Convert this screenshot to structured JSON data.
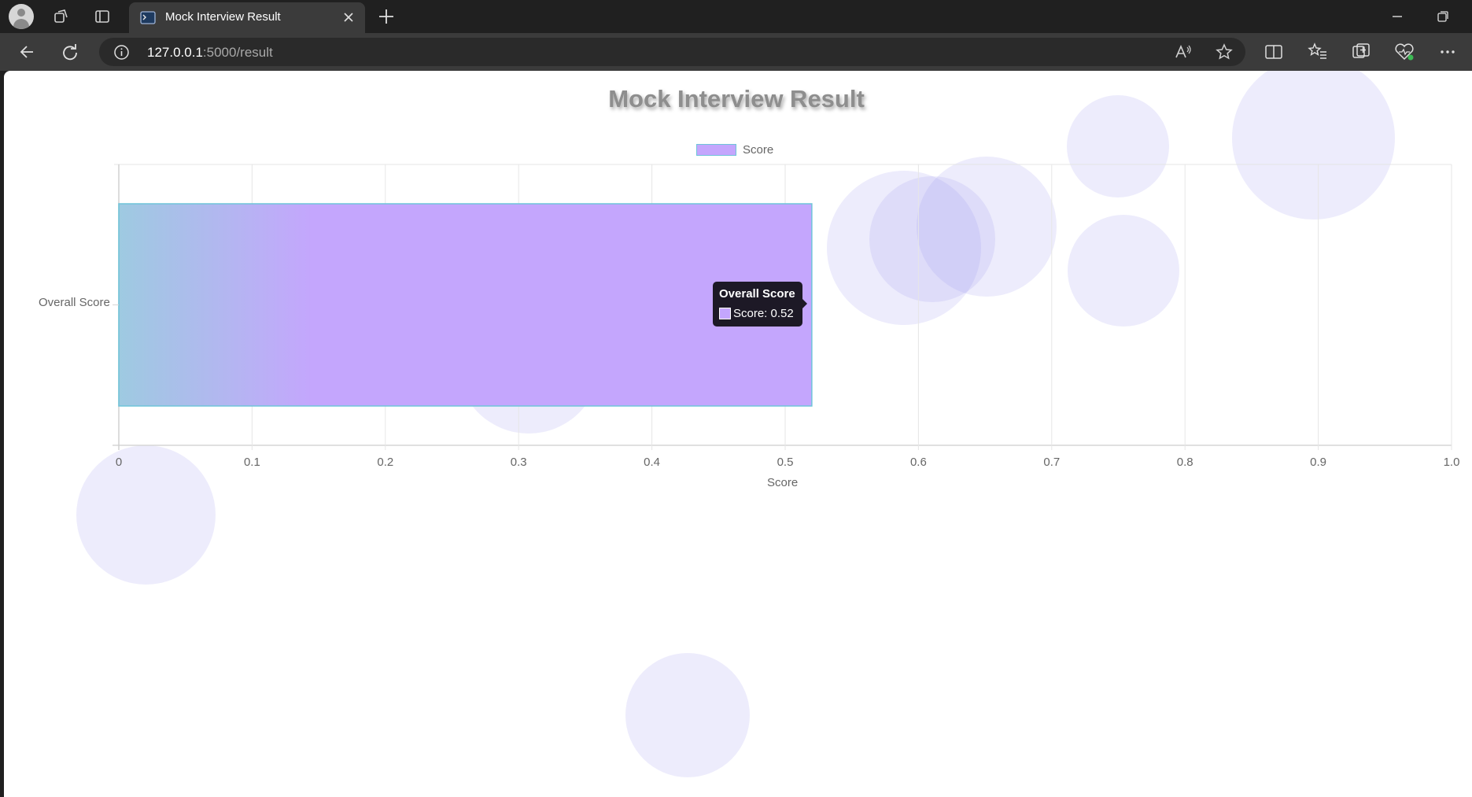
{
  "browser": {
    "tab_title": "Mock Interview Result",
    "url_host": "127.0.0.1",
    "url_path": ":5000/result"
  },
  "page": {
    "title": "Mock Interview Result"
  },
  "chart_data": {
    "type": "bar",
    "orientation": "horizontal",
    "categories": [
      "Overall Score"
    ],
    "series": [
      {
        "name": "Score",
        "values": [
          0.52
        ],
        "color": "#c4a6fd",
        "border_color": "#6fc4d9"
      }
    ],
    "xlabel": "Score",
    "ylabel": "",
    "xlim": [
      0,
      1.0
    ],
    "x_ticks": [
      "0",
      "0.1",
      "0.2",
      "0.3",
      "0.4",
      "0.5",
      "0.6",
      "0.7",
      "0.8",
      "0.9",
      "1.0"
    ],
    "grid": true,
    "legend_position": "top"
  },
  "tooltip": {
    "title": "Overall Score",
    "body": "Score: 0.52"
  },
  "colors": {
    "bar_fill": "#c4a6fd",
    "bar_gradient_start": "#9ecae1",
    "bar_border": "#6fc4d9",
    "title_gray": "#8e8e8e",
    "bubble": "#968cf0"
  }
}
